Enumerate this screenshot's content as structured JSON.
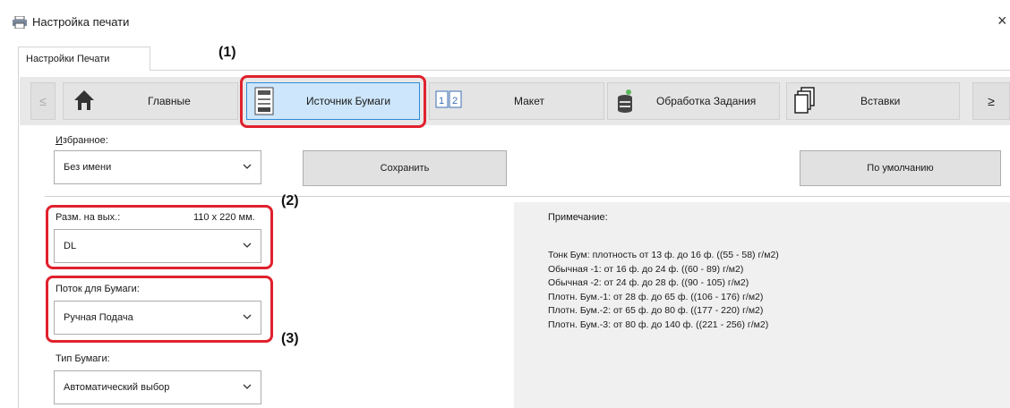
{
  "window": {
    "title": "Настройка печати",
    "close": "×"
  },
  "tabs": [
    {
      "label": "Настройки Печати"
    }
  ],
  "nav": {
    "prev": "≤",
    "next": "≥",
    "items": [
      {
        "label": "Главные",
        "icon": "home-icon"
      },
      {
        "label": "Источник Бумаги",
        "icon": "paper-tray-icon"
      },
      {
        "label": "Макет",
        "icon": "layout-icon"
      },
      {
        "label": "Обработка Задания",
        "icon": "job-handling-icon"
      },
      {
        "label": "Вставки",
        "icon": "inserts-icon"
      }
    ]
  },
  "favorites": {
    "label": "Избранное:",
    "value": "Без имени",
    "save_label": "Сохранить",
    "default_label": "По умолчанию"
  },
  "output_size": {
    "label": "Разм. на вых.:",
    "size_text": "110 x 220 мм.",
    "value": "DL"
  },
  "paper_source": {
    "label": "Поток для Бумаги:",
    "value": "Ручная Подача"
  },
  "paper_type": {
    "label": "Тип Бумаги:",
    "value": "Автоматический выбор"
  },
  "note": {
    "title": "Примечание:",
    "lines": [
      "Тонк Бум: плотность от 13 ф. до 16 ф. ((55 - 58) г/м2)",
      "Обычная -1: от 16 ф. до 24 ф. ((60 - 89) г/м2)",
      "Обычная -2: от 24 ф. до 28 ф. ((90 - 105) г/м2)",
      "Плотн. Бум.-1: от 28 ф. до 65 ф. ((106 - 176) г/м2)",
      "Плотн. Бум.-2: от 65 ф. до 80 ф. ((177 - 220) г/м2)",
      "Плотн. Бум.-3: от 80 ф. до 140 ф. ((221 - 256) г/м2)"
    ]
  },
  "callouts": {
    "c1": "(1)",
    "c2": "(2)",
    "c3": "(3)"
  },
  "colors": {
    "highlight": "#e0212d",
    "active_tab": "#cde6fb",
    "active_border": "#2f8ad9"
  }
}
